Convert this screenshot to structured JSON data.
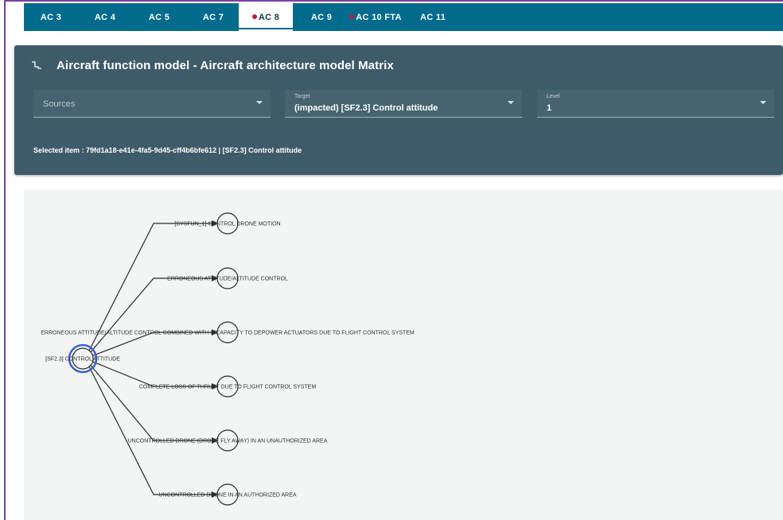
{
  "tabs": [
    {
      "label": "AC 3",
      "dot": false,
      "active": false
    },
    {
      "label": "AC 4",
      "dot": false,
      "active": false
    },
    {
      "label": "AC 5",
      "dot": false,
      "active": false
    },
    {
      "label": "AC 7",
      "dot": false,
      "active": false
    },
    {
      "label": "AC 8",
      "dot": true,
      "active": true
    },
    {
      "label": "AC 9",
      "dot": false,
      "active": false
    },
    {
      "label": "AC 10 FTA",
      "dot": true,
      "active": false
    },
    {
      "label": "AC 11",
      "dot": false,
      "active": false
    }
  ],
  "panel": {
    "icon": "stepped-line-icon",
    "title": "Aircraft function model - Aircraft architecture model Matrix",
    "sources": {
      "placeholder": "Sources"
    },
    "target": {
      "label": "Target",
      "value": "(impacted) [SF2.3] Control attitude"
    },
    "level": {
      "label": "Level",
      "value": "1"
    },
    "selected_item": "Selected item : 79fd1a18-e41e-4fa5-9d45-cff4b6bfe612 | [SF2.3] Control attitude"
  },
  "graph": {
    "center_node": {
      "label": "[SF2.3] CONTROL ATTITUDE",
      "selected": true
    },
    "target_nodes": [
      {
        "label": "[SYSFUN_1] CONTROL DRONE MOTION"
      },
      {
        "label": "ERRONEOUS ATTITUDE/ALTITUDE CONTROL"
      },
      {
        "label": "ERRONEOUS ATTITUDE/ALTITUDE CONTROL COMBINED WITH INCAPACITY TO DEPOWER ACTUATORS DUE TO FLIGHT CONTROL SYSTEM"
      },
      {
        "label": "COMPLETE LOSS OF THRUST DUE TO FLIGHT CONTROL SYSTEM"
      },
      {
        "label": "UNCONTROLLED DRONE (DRONE FLY AWAY) IN AN UNAUTHORIZED AREA"
      },
      {
        "label": "UNCONTROLLED DRONE IN AN AUTHORIZED AREA"
      }
    ],
    "colors": {
      "edge": "#2b2b2b",
      "node_stroke": "#2b2b2b",
      "selected_ring": "#3b5fd6"
    }
  }
}
